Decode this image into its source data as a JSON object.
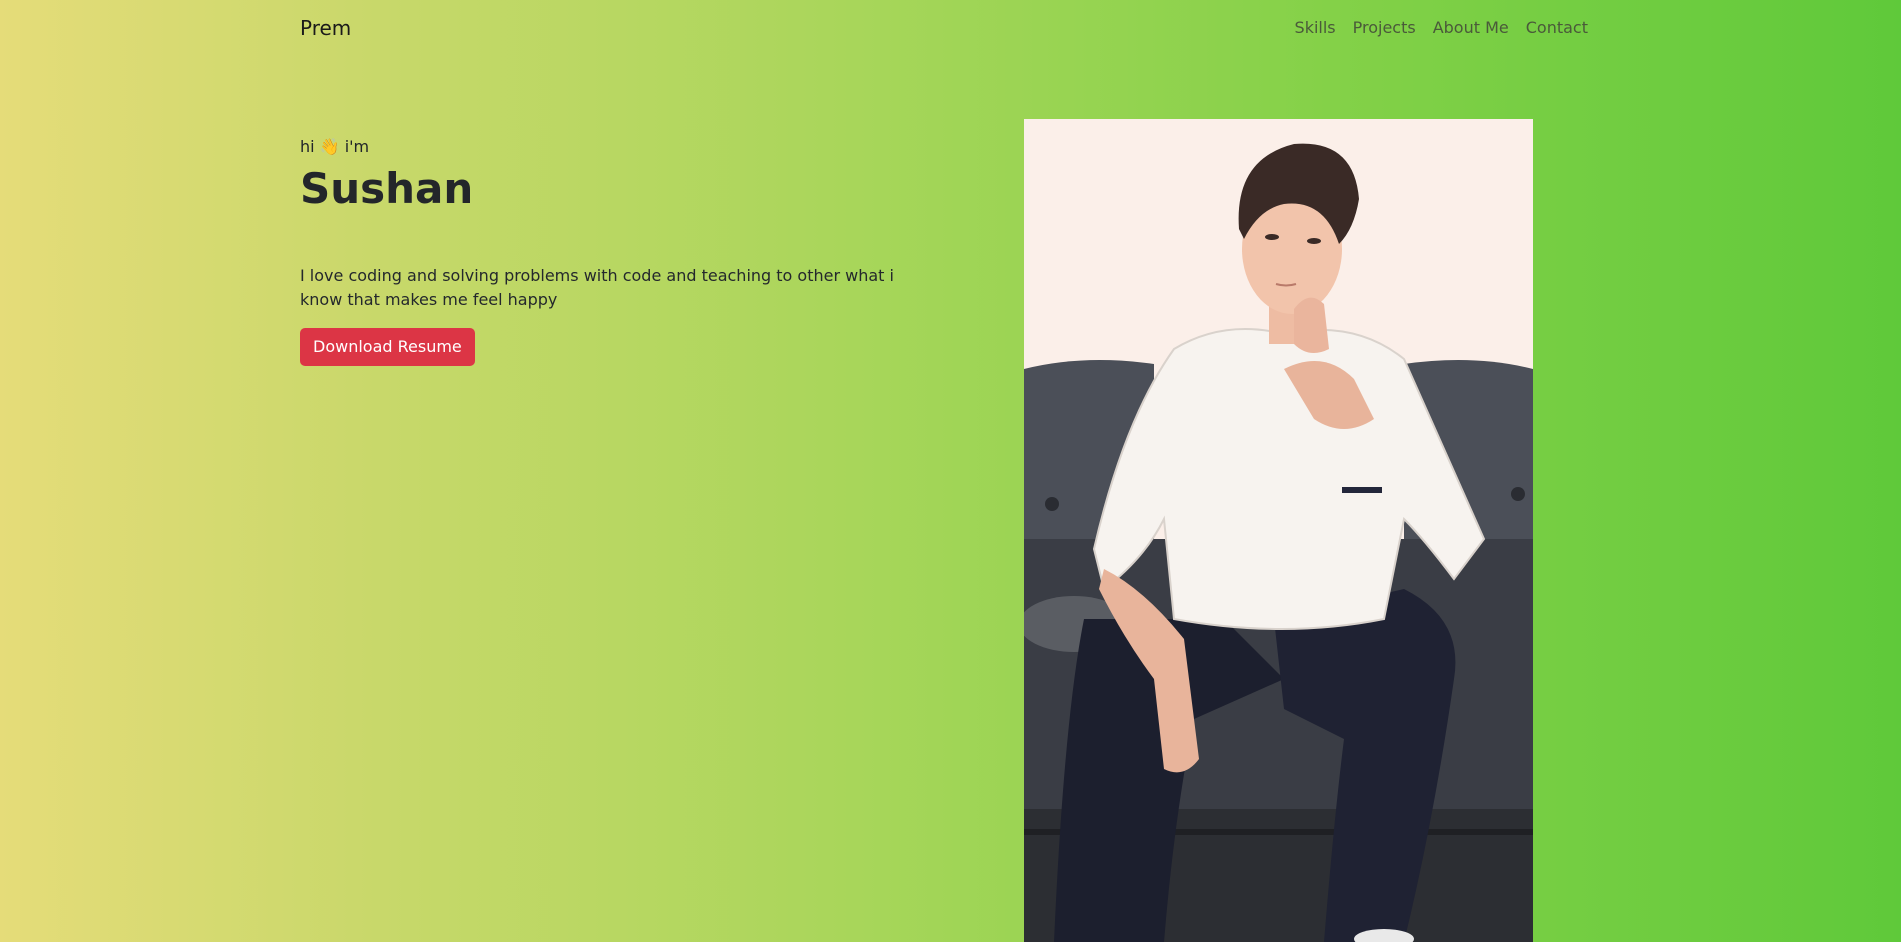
{
  "navbar": {
    "brand": "Prem",
    "links": [
      "Skills",
      "Projects",
      "About Me",
      "Contact"
    ]
  },
  "hero": {
    "greeting_prefix": "hi",
    "greeting_emoji": "👋",
    "greeting_suffix": "i'm",
    "name": "Sushan",
    "bio": "I love coding and solving problems with code and teaching to other what i know that makes me feel happy",
    "button_label": "Download Resume"
  },
  "colors": {
    "gradient_start": "#e5dc79",
    "gradient_end": "#5fc93a",
    "button": "#dc3545"
  },
  "image": {
    "icon": "portrait-illustration"
  }
}
